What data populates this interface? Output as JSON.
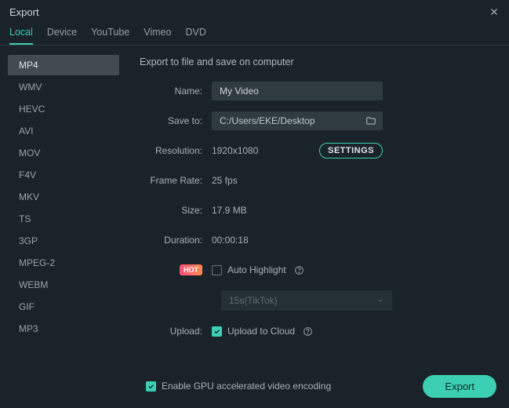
{
  "window": {
    "title": "Export"
  },
  "tabs": {
    "items": [
      "Local",
      "Device",
      "YouTube",
      "Vimeo",
      "DVD"
    ],
    "active": 0
  },
  "sidebar": {
    "formats": [
      "MP4",
      "WMV",
      "HEVC",
      "AVI",
      "MOV",
      "F4V",
      "MKV",
      "TS",
      "3GP",
      "MPEG-2",
      "WEBM",
      "GIF",
      "MP3"
    ],
    "selected": 0
  },
  "content": {
    "heading": "Export to file and save on computer",
    "labels": {
      "name": "Name:",
      "save_to": "Save to:",
      "resolution": "Resolution:",
      "frame_rate": "Frame Rate:",
      "size": "Size:",
      "duration": "Duration:",
      "upload": "Upload:"
    },
    "name_value": "My Video",
    "save_to_value": "C:/Users/EKE/Desktop",
    "resolution_value": "1920x1080",
    "settings_label": "SETTINGS",
    "frame_rate_value": "25 fps",
    "size_value": "17.9 MB",
    "duration_value": "00:00:18",
    "hot_badge": "HOT",
    "auto_highlight_label": "Auto Highlight",
    "auto_highlight_checked": false,
    "preset_value": "15s(TikTok)",
    "upload_to_cloud_label": "Upload to Cloud",
    "upload_to_cloud_checked": true
  },
  "footer": {
    "gpu_label": "Enable GPU accelerated video encoding",
    "gpu_checked": true,
    "export_label": "Export"
  }
}
